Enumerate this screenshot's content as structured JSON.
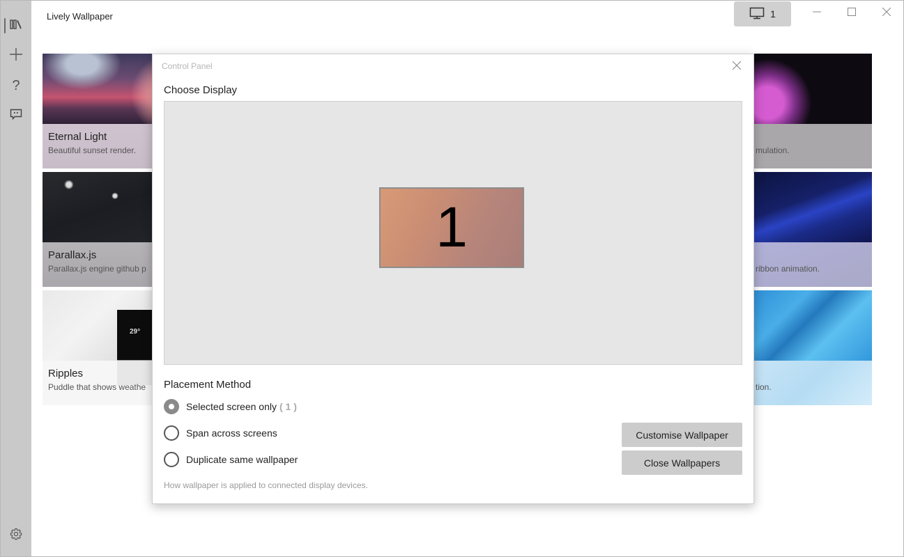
{
  "app": {
    "title": "Lively Wallpaper"
  },
  "sidebar": {
    "items": [
      {
        "name": "library",
        "icon": "library-icon",
        "active": true
      },
      {
        "name": "add-wallpaper",
        "icon": "plus-icon"
      },
      {
        "name": "help",
        "icon": "help-icon"
      },
      {
        "name": "feedback",
        "icon": "feedback-icon"
      }
    ],
    "settings_icon": "gear-icon"
  },
  "titlebar": {
    "display_button_label": "1",
    "display_icon": "monitor-icon",
    "minimize_icon": "minimize-icon",
    "maximize_icon": "maximize-icon",
    "close_icon": "close-icon"
  },
  "library": {
    "left_cards": [
      {
        "title": "Eternal Light",
        "desc": "Beautiful sunset render."
      },
      {
        "title": "Parallax.js",
        "desc": "Parallax.js engine github p"
      },
      {
        "title": "Ripples",
        "desc": "Puddle that shows weathe"
      }
    ],
    "right_cards": [
      {
        "desc": "mulation."
      },
      {
        "desc": "ribbon animation."
      },
      {
        "desc": "tion."
      }
    ]
  },
  "dialog": {
    "title": "Control Panel",
    "choose_display_label": "Choose Display",
    "monitor_number": "1",
    "placement_label": "Placement Method",
    "options": [
      {
        "label": "Selected screen only",
        "extra": "( 1 )",
        "checked": true
      },
      {
        "label": "Span across screens",
        "checked": false
      },
      {
        "label": "Duplicate same wallpaper",
        "checked": false
      }
    ],
    "hint": "How wallpaper is applied to connected display devices.",
    "customise_button": "Customise Wallpaper",
    "close_wallpapers_button": "Close Wallpapers"
  }
}
